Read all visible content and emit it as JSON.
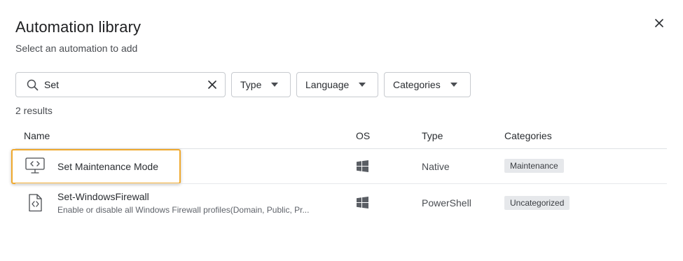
{
  "dialog": {
    "title": "Automation library",
    "subtitle": "Select an automation to add",
    "close_icon": "close-icon"
  },
  "search": {
    "value": "Set",
    "placeholder": "Search",
    "icon": "search-icon",
    "clear_icon": "clear-icon"
  },
  "filters": [
    {
      "label": "Type"
    },
    {
      "label": "Language"
    },
    {
      "label": "Categories"
    }
  ],
  "results_count": "2 results",
  "table": {
    "headers": [
      "Name",
      "OS",
      "Type",
      "Categories"
    ],
    "rows": [
      {
        "icon": "monitor-code-icon",
        "name": "Set Maintenance Mode",
        "description": "",
        "os": "windows-icon",
        "type": "Native",
        "category": "Maintenance",
        "highlighted": true
      },
      {
        "icon": "script-file-icon",
        "name": "Set-WindowsFirewall",
        "description": "Enable or disable all Windows Firewall profiles(Domain, Public, Pr...",
        "os": "windows-icon",
        "type": "PowerShell",
        "category": "Uncategorized",
        "highlighted": false
      }
    ]
  },
  "colors": {
    "highlight_border": "#f0a92e",
    "badge_bg": "#e6e8eb",
    "border": "#c7cacf"
  }
}
